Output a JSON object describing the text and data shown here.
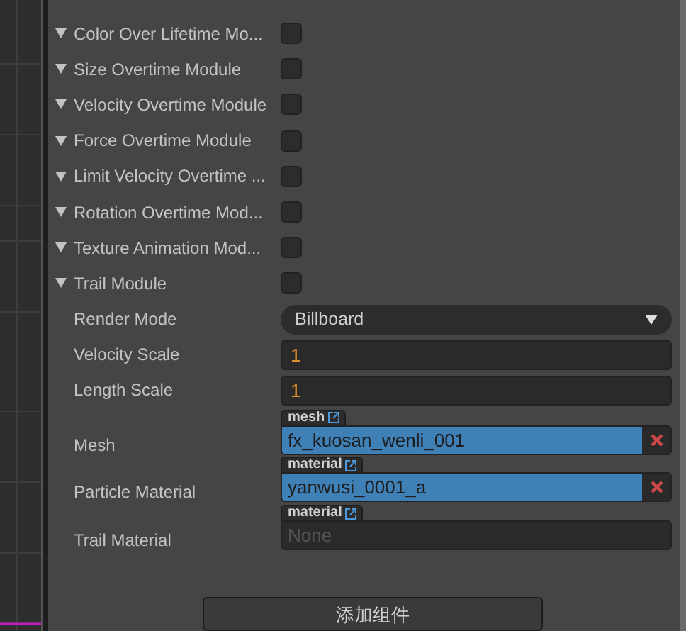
{
  "modules": [
    {
      "name": "Color Over Lifetime Mo...",
      "checked": false
    },
    {
      "name": "Size Overtime Module",
      "checked": false
    },
    {
      "name": "Velocity Overtime Module",
      "checked": false
    },
    {
      "name": "Force Overtime Module",
      "checked": false
    },
    {
      "name": "Limit Velocity Overtime ...",
      "checked": false
    },
    {
      "name": "Rotation Overtime Mod...",
      "checked": false
    },
    {
      "name": "Texture Animation Mod...",
      "checked": false
    },
    {
      "name": "Trail Module",
      "checked": false
    }
  ],
  "properties": [
    {
      "kind": "dropdown",
      "label": "Render Mode",
      "value": "Billboard"
    },
    {
      "kind": "number",
      "label": "Velocity Scale",
      "value": "1"
    },
    {
      "kind": "number",
      "label": "Length Scale",
      "value": "1"
    },
    {
      "kind": "asset",
      "label": "Mesh",
      "tag": "mesh",
      "value": "fx_kuosan_wenli_001"
    },
    {
      "kind": "asset",
      "label": "Particle Material",
      "tag": "material",
      "value": "yanwusi_0001_a"
    },
    {
      "kind": "asset",
      "label": "Trail Material",
      "tag": "material",
      "placeholder": "None"
    }
  ],
  "add_button": "添加组件"
}
